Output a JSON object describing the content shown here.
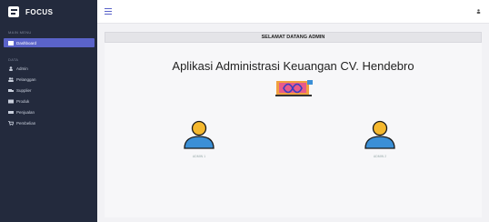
{
  "brand": {
    "name": "FOCUS"
  },
  "sidebar": {
    "section_main": "MAIN MENU",
    "dashboard": "Dashboard",
    "section_data": "DATA",
    "items": [
      {
        "label": "Admin",
        "icon": "user-icon"
      },
      {
        "label": "Pelanggan",
        "icon": "users-icon"
      },
      {
        "label": "Supplier",
        "icon": "truck-icon"
      },
      {
        "label": "Produk",
        "icon": "box-icon"
      },
      {
        "label": "Penjualan",
        "icon": "sales-icon"
      },
      {
        "label": "Pembelian",
        "icon": "cart-icon"
      }
    ]
  },
  "main": {
    "welcome": "SELAMAT DATANG ADMIN",
    "title": "Aplikasi Administrasi Keuangan CV. Hendebro",
    "avatars": [
      {
        "label": "ADMIN 1"
      },
      {
        "label": "ADMIN 2"
      }
    ]
  },
  "colors": {
    "sidebar_bg": "#232a3d",
    "accent": "#5a63c9",
    "avatar_head": "#f5b82e",
    "avatar_body": "#3b8fd6"
  }
}
